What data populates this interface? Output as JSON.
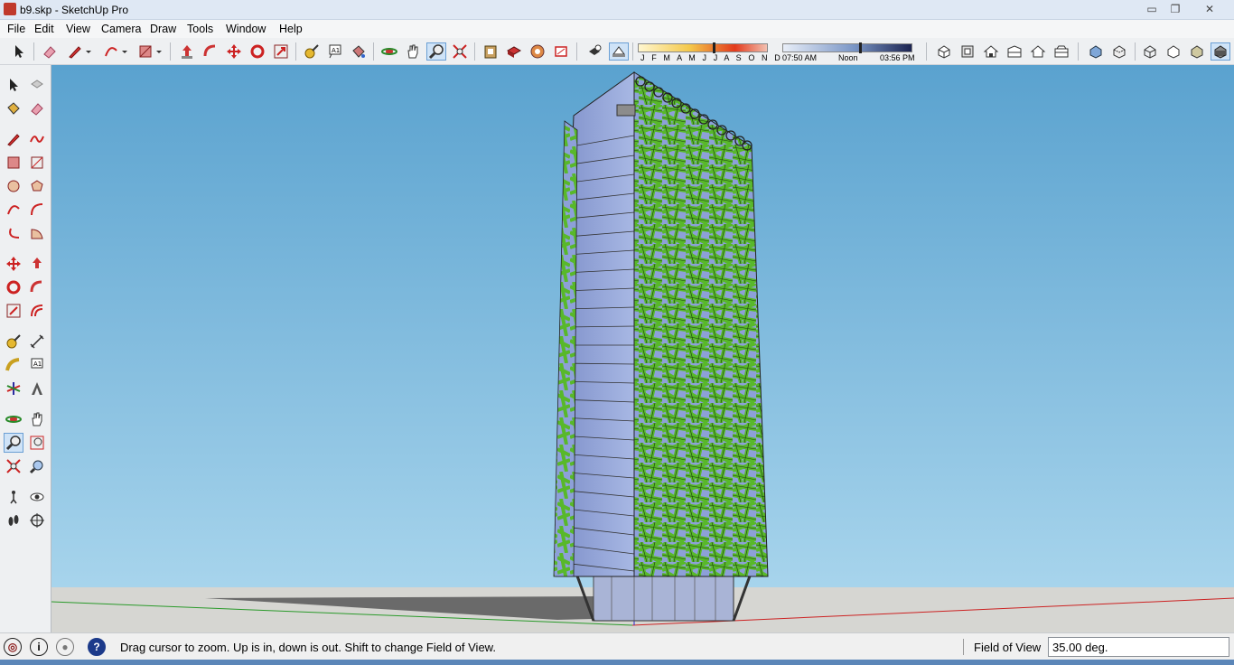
{
  "window": {
    "title": "b9.skp - SketchUp Pro"
  },
  "menus": [
    "File",
    "Edit",
    "View",
    "Camera",
    "Draw",
    "Tools",
    "Window",
    "Help"
  ],
  "toolbar": {
    "months": "J F M A M J J A S O N D",
    "time_start": "07:50 AM",
    "time_noon": "Noon",
    "time_end": "03:56 PM",
    "month_progress": 0.58,
    "time_progress": 0.59
  },
  "status": {
    "hint": "Drag cursor to zoom.  Up is in, down is out. Shift to change Field of View.",
    "vcb_label": "Field of View",
    "vcb_value": "35.00 deg."
  },
  "icons": {
    "top": [
      "select-icon",
      "eraser-icon",
      "pencil-icon",
      "arc-icon",
      "rectangle-icon",
      "push-pull-icon",
      "follow-me-icon",
      "move-icon",
      "rotate-icon",
      "scale-icon",
      "tape-measure-icon",
      "text-icon",
      "paint-bucket-icon",
      "orbit-icon",
      "pan-icon",
      "zoom-icon",
      "zoom-extents-icon",
      "warehouse-icon",
      "components-icon",
      "extension-icon",
      "styles-icon",
      "shadows-toggle-icon",
      "fog-icon",
      "iso-view-icon",
      "top-view-icon",
      "front-view-icon",
      "right-view-icon",
      "back-view-icon",
      "left-view-icon",
      "xray-icon",
      "back-edges-icon",
      "wireframe-icon",
      "hidden-line-icon",
      "shaded-icon",
      "shaded-textures-icon"
    ],
    "left": [
      "select-icon",
      "component-icon",
      "paint-bucket-icon",
      "eraser-icon",
      "pencil-icon",
      "freehand-icon",
      "rectangle-icon",
      "rotated-rectangle-icon",
      "circle-icon",
      "polygon-icon",
      "arc-icon",
      "two-point-arc-icon",
      "three-point-arc-icon",
      "pie-icon",
      "move-icon",
      "push-pull-icon",
      "rotate-icon",
      "follow-me-icon",
      "scale-icon",
      "offset-icon",
      "tape-measure-icon",
      "dimension-icon",
      "protractor-icon",
      "text-icon",
      "axes-icon",
      "3d-text-icon",
      "orbit-icon",
      "pan-icon",
      "zoom-icon",
      "zoom-window-icon",
      "zoom-extents-icon",
      "previous-view-icon",
      "position-camera-icon",
      "look-around-icon",
      "walk-icon",
      "section-plane-icon"
    ]
  },
  "colors": {
    "sky_top": "#5aa2cf",
    "sky_bottom": "#a7d4ec",
    "ground": "#d6d6d2",
    "facade_green": "#58b82a",
    "glass": "#8fa3d6"
  }
}
